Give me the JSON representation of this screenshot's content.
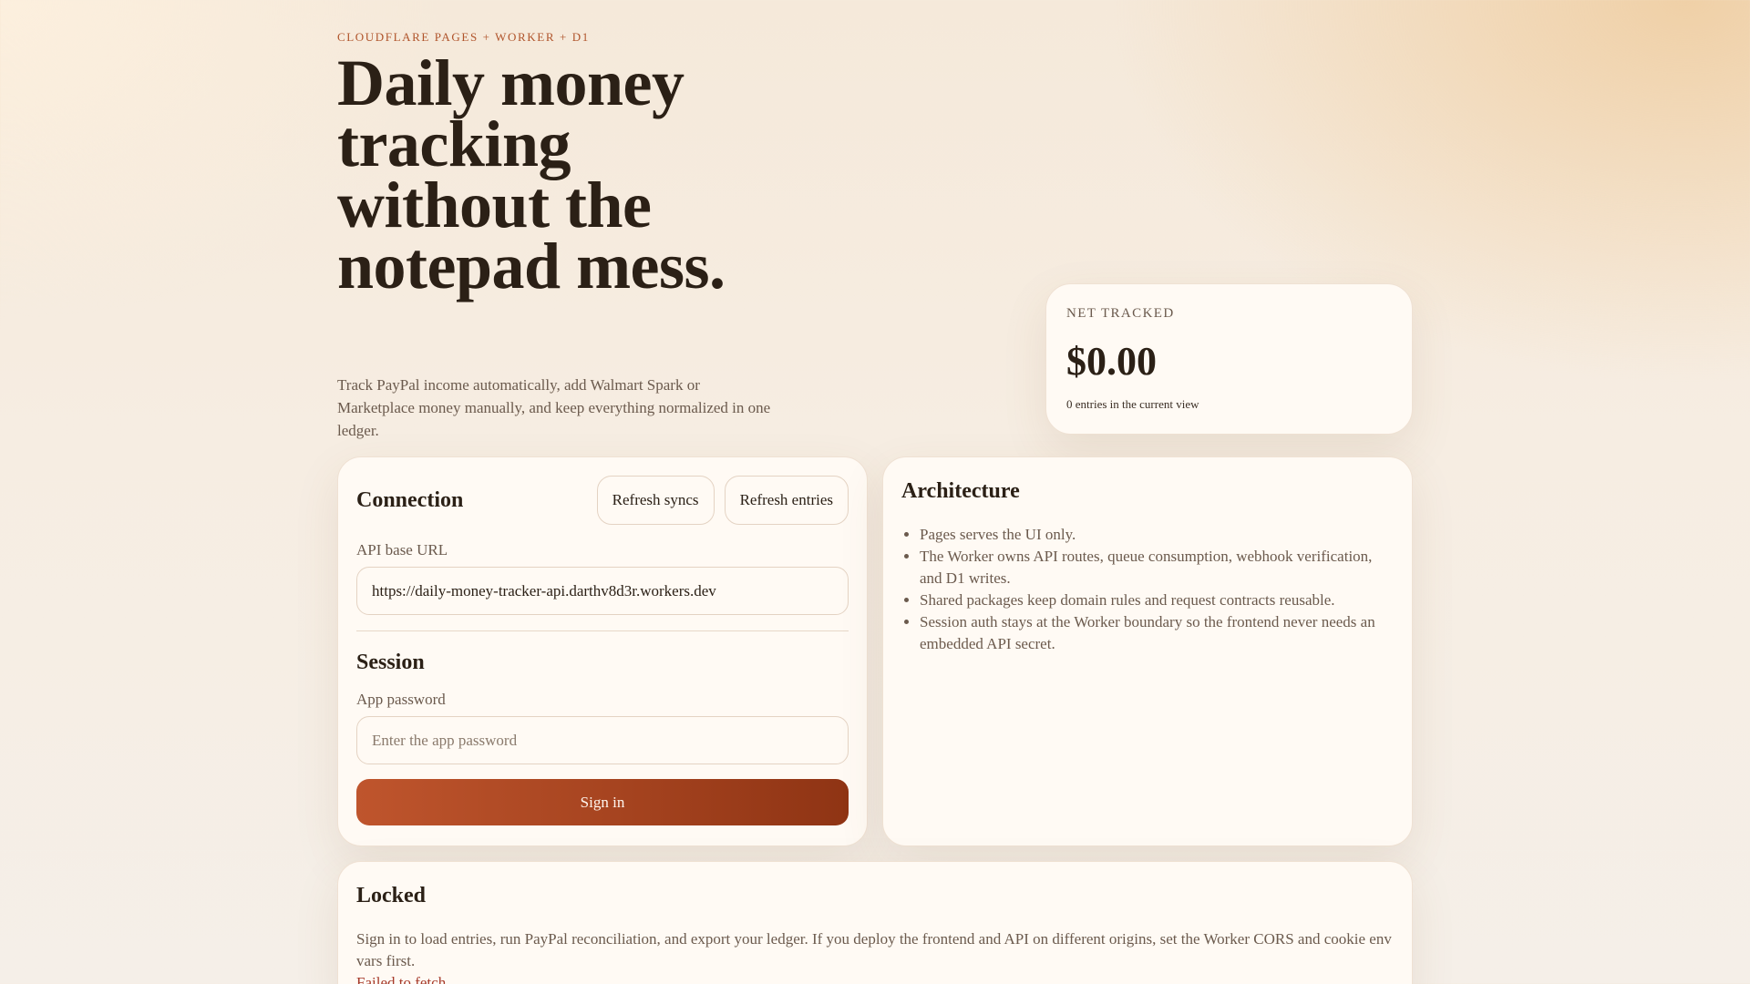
{
  "hero": {
    "eyebrow": "CLOUDFLARE PAGES + WORKER + D1",
    "title": "Daily money tracking without the notepad mess.",
    "subtitle": "Track PayPal income automatically, add Walmart Spark or Marketplace money manually, and keep everything normalized in one ledger."
  },
  "net": {
    "label": "NET TRACKED",
    "value": "$0.00",
    "note": "0 entries in the current view"
  },
  "connection": {
    "title": "Connection",
    "refresh_syncs_label": "Refresh syncs",
    "refresh_entries_label": "Refresh entries",
    "api_label": "API base URL",
    "api_value": "https://daily-money-tracker-api.darthv8d3r.workers.dev"
  },
  "session": {
    "title": "Session",
    "password_label": "App password",
    "password_placeholder": "Enter the app password",
    "sign_in_label": "Sign in"
  },
  "architecture": {
    "title": "Architecture",
    "items": [
      "Pages serves the UI only.",
      "The Worker owns API routes, queue consumption, webhook verification, and D1 writes.",
      "Shared packages keep domain rules and request contracts reusable.",
      "Session auth stays at the Worker boundary so the frontend never needs an embedded API secret."
    ]
  },
  "locked": {
    "title": "Locked",
    "message": "Sign in to load entries, run PayPal reconciliation, and export your ledger. If you deploy the frontend and API on different origins, set the Worker CORS and cookie env vars first.",
    "error": "Failed to fetch"
  }
}
